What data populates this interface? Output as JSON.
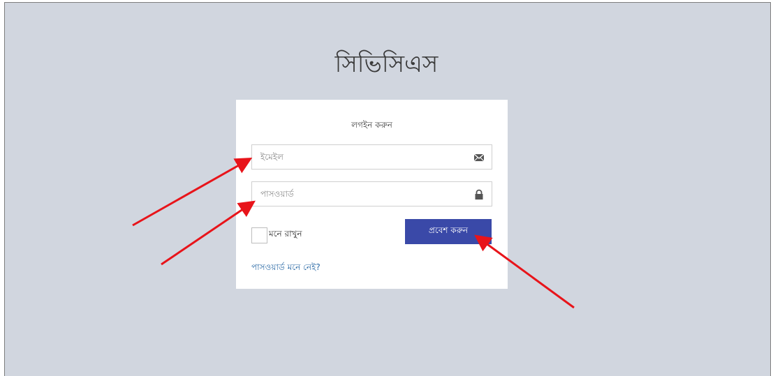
{
  "app": {
    "title": "সিভিসিএস"
  },
  "login": {
    "heading": "লগইন করুন",
    "email": {
      "placeholder": "ইমেইল",
      "value": "",
      "icon": "envelope-icon"
    },
    "password": {
      "placeholder": "পাসওয়ার্ড",
      "value": "",
      "icon": "lock-icon"
    },
    "remember_label": "মনে রাখুন",
    "remember_checked": false,
    "submit_label": "প্রবেশ করুন",
    "forgot_label": "পাসওয়ার্ড মনে নেই?"
  },
  "colors": {
    "background": "#d1d6df",
    "panel": "#ffffff",
    "primary_button": "#3a49a8",
    "link": "#2b6aa6",
    "annotation_arrow": "#e8141a"
  }
}
